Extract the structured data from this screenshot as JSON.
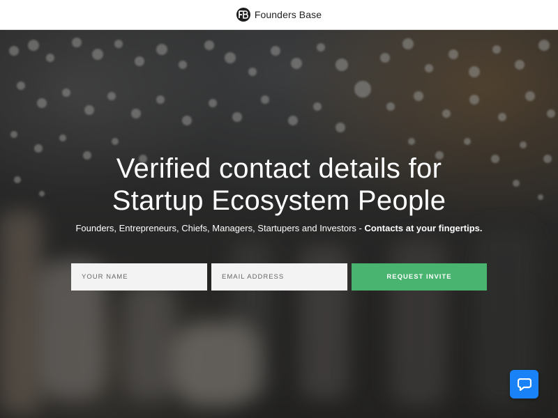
{
  "header": {
    "brand_name": "Founders Base",
    "logo_text": "FB",
    "logo_icon": "founders-base-logo-icon"
  },
  "hero": {
    "headline_line1": "Verified contact details for",
    "headline_line2": "Startup Ecosystem People",
    "subline_text": "Founders, Entrepreneurs, Chiefs, Managers, Startupers and Investors - ",
    "subline_emphasis": "Contacts at your fingertips."
  },
  "form": {
    "name_placeholder": "YOUR NAME",
    "name_value": "",
    "email_placeholder": "EMAIL ADDRESS",
    "email_value": "",
    "submit_label": "REQUEST INVITE"
  },
  "chat": {
    "icon": "chat-bubble-icon"
  },
  "colors": {
    "accent_green": "#48b46f",
    "chat_blue": "#1a82f7",
    "header_bg": "#ffffff"
  }
}
